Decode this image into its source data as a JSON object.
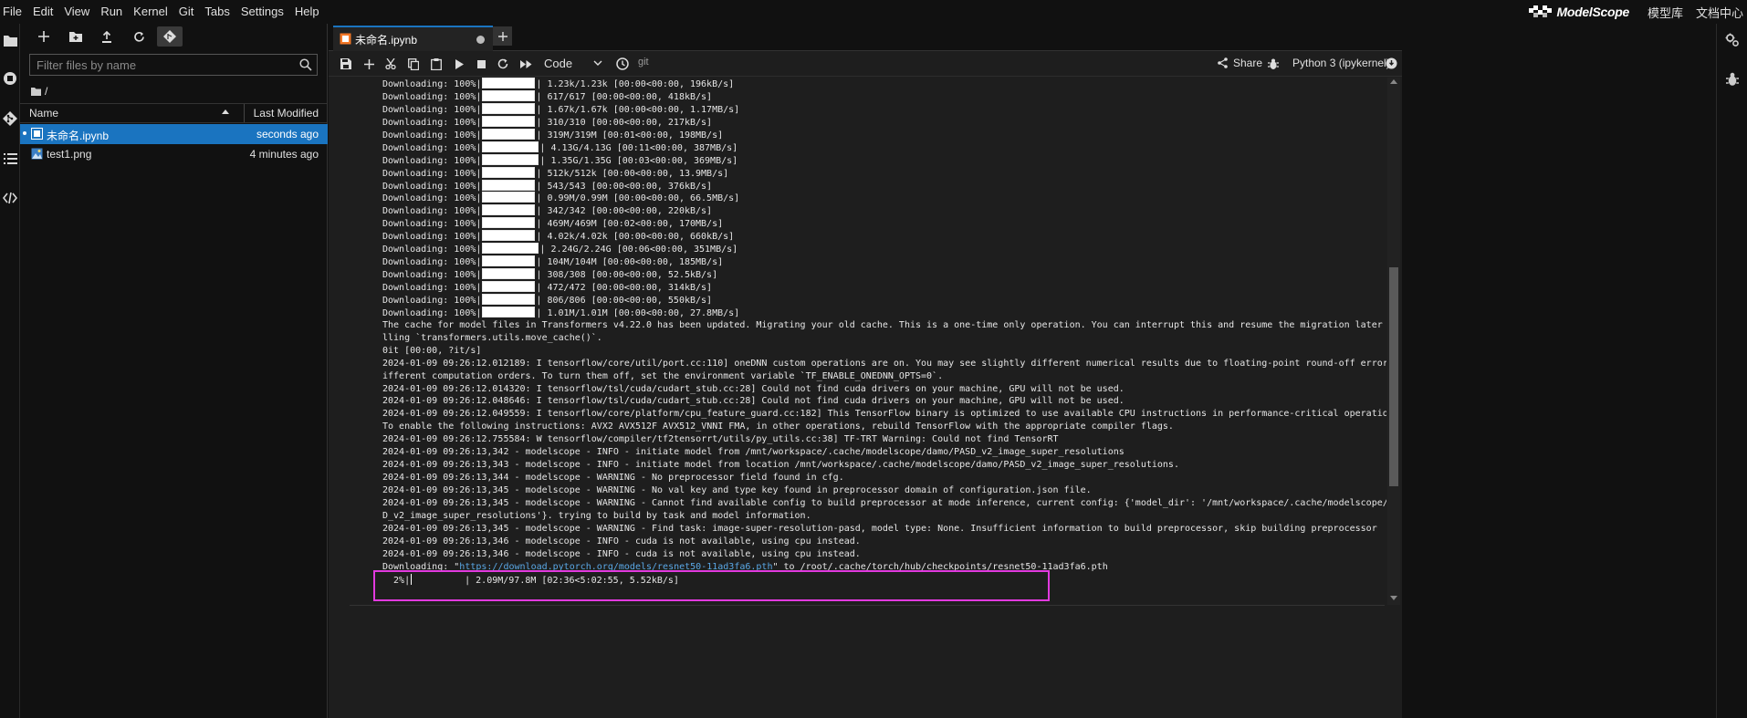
{
  "menubar": {
    "items": [
      "File",
      "Edit",
      "View",
      "Run",
      "Kernel",
      "Git",
      "Tabs",
      "Settings",
      "Help"
    ],
    "brand": "ModelScope",
    "links": [
      "模型库",
      "文档中心"
    ]
  },
  "activitybar": {
    "icons": [
      "folder-icon",
      "running-icon",
      "git-icon",
      "toc-icon",
      "extension-icon"
    ]
  },
  "filebrowser": {
    "toolbar": [
      "new-launcher-icon",
      "new-folder-icon",
      "upload-icon",
      "refresh-icon",
      "git-clone-icon"
    ],
    "search_placeholder": "Filter files by name",
    "path": "/",
    "header": {
      "name": "Name",
      "modified": "Last Modified"
    },
    "files": [
      {
        "name": "未命名.ipynb",
        "modified": "seconds ago",
        "selected": true,
        "type": "notebook"
      },
      {
        "name": "test1.png",
        "modified": "4 minutes ago",
        "selected": false,
        "type": "image"
      }
    ]
  },
  "tabs": [
    {
      "label": "未命名.ipynb",
      "dirty": true
    }
  ],
  "notebook_toolbar": {
    "cell_type": "Code",
    "git": "git",
    "share": "Share",
    "kernel": "Python 3 (ipykernel)"
  },
  "downloads": [
    {
      "label": "Downloading:",
      "percent": "100%",
      "info": "1.23k/1.23k [00:00<00:00, 196kB/s]"
    },
    {
      "label": "Downloading:",
      "percent": "100%",
      "info": "617/617 [00:00<00:00, 418kB/s]"
    },
    {
      "label": "Downloading:",
      "percent": "100%",
      "info": "1.67k/1.67k [00:00<00:00, 1.17MB/s]"
    },
    {
      "label": "Downloading:",
      "percent": "100%",
      "info": "310/310 [00:00<00:00, 217kB/s]"
    },
    {
      "label": "Downloading:",
      "percent": "100%",
      "info": "319M/319M [00:01<00:00, 198MB/s]"
    },
    {
      "label": "Downloading:",
      "percent": "100%",
      "info": "4.13G/4.13G [00:11<00:00, 387MB/s]"
    },
    {
      "label": "Downloading:",
      "percent": "100%",
      "info": "1.35G/1.35G [00:03<00:00, 369MB/s]"
    },
    {
      "label": "Downloading:",
      "percent": "100%",
      "info": "512k/512k [00:00<00:00, 13.9MB/s]"
    },
    {
      "label": "Downloading:",
      "percent": "100%",
      "info": "543/543 [00:00<00:00, 376kB/s]"
    },
    {
      "label": "Downloading:",
      "percent": "100%",
      "info": "0.99M/0.99M [00:00<00:00, 66.5MB/s]"
    },
    {
      "label": "Downloading:",
      "percent": "100%",
      "info": "342/342 [00:00<00:00, 220kB/s]"
    },
    {
      "label": "Downloading:",
      "percent": "100%",
      "info": "469M/469M [00:02<00:00, 170MB/s]"
    },
    {
      "label": "Downloading:",
      "percent": "100%",
      "info": "4.02k/4.02k [00:00<00:00, 660kB/s]"
    },
    {
      "label": "Downloading:",
      "percent": "100%",
      "info": "2.24G/2.24G [00:06<00:00, 351MB/s]"
    },
    {
      "label": "Downloading:",
      "percent": "100%",
      "info": "104M/104M [00:00<00:00, 185MB/s]"
    },
    {
      "label": "Downloading:",
      "percent": "100%",
      "info": "308/308 [00:00<00:00, 52.5kB/s]"
    },
    {
      "label": "Downloading:",
      "percent": "100%",
      "info": "472/472 [00:00<00:00, 314kB/s]"
    },
    {
      "label": "Downloading:",
      "percent": "100%",
      "info": "806/806 [00:00<00:00, 550kB/s]"
    },
    {
      "label": "Downloading:",
      "percent": "100%",
      "info": "1.01M/1.01M [00:00<00:00, 27.8MB/s]"
    }
  ],
  "log_lines": [
    "The cache for model files in Transformers v4.22.0 has been updated. Migrating your old cache. This is a one-time only operation. You can interrupt this and resume the migration later on by ca",
    "lling `transformers.utils.move_cache()`.",
    "0it [00:00, ?it/s]",
    "2024-01-09 09:26:12.012189: I tensorflow/core/util/port.cc:110] oneDNN custom operations are on. You may see slightly different numerical results due to floating-point round-off errors from d",
    "ifferent computation orders. To turn them off, set the environment variable `TF_ENABLE_ONEDNN_OPTS=0`.",
    "2024-01-09 09:26:12.014320: I tensorflow/tsl/cuda/cudart_stub.cc:28] Could not find cuda drivers on your machine, GPU will not be used.",
    "2024-01-09 09:26:12.048646: I tensorflow/tsl/cuda/cudart_stub.cc:28] Could not find cuda drivers on your machine, GPU will not be used.",
    "2024-01-09 09:26:12.049559: I tensorflow/core/platform/cpu_feature_guard.cc:182] This TensorFlow binary is optimized to use available CPU instructions in performance-critical operations.",
    "To enable the following instructions: AVX2 AVX512F AVX512_VNNI FMA, in other operations, rebuild TensorFlow with the appropriate compiler flags.",
    "2024-01-09 09:26:12.755584: W tensorflow/compiler/tf2tensorrt/utils/py_utils.cc:38] TF-TRT Warning: Could not find TensorRT",
    "2024-01-09 09:26:13,342 - modelscope - INFO - initiate model from /mnt/workspace/.cache/modelscope/damo/PASD_v2_image_super_resolutions",
    "2024-01-09 09:26:13,343 - modelscope - INFO - initiate model from location /mnt/workspace/.cache/modelscope/damo/PASD_v2_image_super_resolutions.",
    "2024-01-09 09:26:13,344 - modelscope - WARNING - No preprocessor field found in cfg.",
    "2024-01-09 09:26:13,345 - modelscope - WARNING - No val key and type key found in preprocessor domain of configuration.json file.",
    "2024-01-09 09:26:13,345 - modelscope - WARNING - Cannot find available config to build preprocessor at mode inference, current config: {'model_dir': '/mnt/workspace/.cache/modelscope/damo/PAS",
    "D_v2_image_super_resolutions'}. trying to build by task and model information.",
    "2024-01-09 09:26:13,345 - modelscope - WARNING - Find task: image-super-resolution-pasd, model type: None. Insufficient information to build preprocessor, skip building preprocessor",
    "2024-01-09 09:26:13,346 - modelscope - INFO - cuda is not available, using cpu instead.",
    "2024-01-09 09:26:13,346 - modelscope - INFO - cuda is not available, using cpu instead."
  ],
  "final_download": {
    "prefix": "Downloading: \"",
    "url": "https://download.pytorch.org/models/resnet50-11ad3fa6.pth",
    "suffix": "\" to /root/.cache/torch/hub/checkpoints/resnet50-11ad3fa6.pth",
    "percent": "  2%",
    "progress": 0.02,
    "info": "| 2.09M/97.8M [02:36<5:02:55, 5.52kB/s]"
  },
  "highlight_color": "#e23adf",
  "accent_color": "#1a74c0"
}
